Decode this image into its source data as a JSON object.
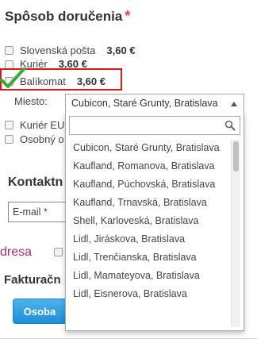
{
  "section": {
    "title": "Spôsob doručenia",
    "required_mark": "*"
  },
  "shipping_options": [
    {
      "label": "Slovenská pošta",
      "price": "3,60 €"
    },
    {
      "label": "Kuriér",
      "price": "3,60 €"
    },
    {
      "label": "Balíkomat",
      "price": "3,60 €",
      "selected": true
    },
    {
      "label": "Kuriér EU"
    },
    {
      "label": "Osobný o"
    }
  ],
  "miesto": {
    "label": "Miesto:",
    "selected": "Cubicon, Staré Grunty, Bratislava"
  },
  "dropdown": {
    "search_value": "",
    "items": [
      "Cubicon, Staré Grunty, Bratislava",
      "Kaufland, Romanova, Bratislava",
      "Kaufland, Púchovská, Bratislava",
      "Kaufland, Trnavská, Bratislava",
      "Shell, Karloveská, Bratislava",
      "Lidl, Jiráskova, Bratislava",
      "Lidl, Trenčianska, Bratislava",
      "Lidl, Mamateyova, Bratislava",
      "Lidl, Eisnerova, Bratislava"
    ]
  },
  "contact": {
    "title": "Kontaktn",
    "email_placeholder": "E-mail *"
  },
  "address": {
    "label": "dresa"
  },
  "billing": {
    "title": "Fakturačn",
    "osoba_button": "Osoba"
  },
  "colors": {
    "accent_blue": "#1d8ed8",
    "highlight_red": "#d8191b",
    "check_green": "#3aaa35",
    "adresa_purple": "#b2267a"
  }
}
